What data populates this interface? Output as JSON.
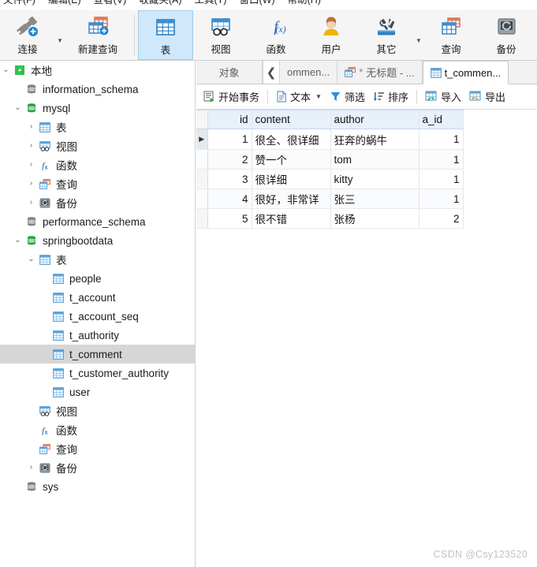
{
  "window": {
    "menu": [
      {
        "label": "文件(F)"
      },
      {
        "label": "编辑(E)"
      },
      {
        "label": "查看(V)"
      },
      {
        "label": "收藏夹(A)"
      },
      {
        "label": "工具(T)"
      },
      {
        "label": "窗口(W)"
      },
      {
        "label": "帮助(H)"
      }
    ]
  },
  "ribbon": {
    "buttons": [
      {
        "label": "连接",
        "icon": "connection-icon",
        "caret": true,
        "active": false
      },
      {
        "label": "新建查询",
        "icon": "new-query-icon",
        "caret": false,
        "active": false
      },
      {
        "label": "表",
        "icon": "table-icon",
        "caret": false,
        "active": true
      },
      {
        "label": "视图",
        "icon": "view-icon",
        "caret": false,
        "active": false
      },
      {
        "label": "函数",
        "icon": "function-icon",
        "caret": false,
        "active": false
      },
      {
        "label": "用户",
        "icon": "user-icon",
        "caret": false,
        "active": false
      },
      {
        "label": "其它",
        "icon": "other-tools-icon",
        "caret": true,
        "active": false
      },
      {
        "label": "查询",
        "icon": "query-icon",
        "caret": false,
        "active": false
      },
      {
        "label": "备份",
        "icon": "backup-icon",
        "caret": false,
        "active": false
      }
    ]
  },
  "tree": {
    "nodes": [
      {
        "label": "本地",
        "indent": 0,
        "twist": "down",
        "icon": "connection-green-icon",
        "selected": false
      },
      {
        "label": "information_schema",
        "indent": 1,
        "twist": "none",
        "icon": "database-gray-icon",
        "selected": false
      },
      {
        "label": "mysql",
        "indent": 1,
        "twist": "down",
        "icon": "database-green-icon",
        "selected": false
      },
      {
        "label": "表",
        "indent": 2,
        "twist": "right",
        "icon": "table-icon",
        "selected": false
      },
      {
        "label": "视图",
        "indent": 2,
        "twist": "right",
        "icon": "view-icon",
        "selected": false
      },
      {
        "label": "函数",
        "indent": 2,
        "twist": "right",
        "icon": "function-icon",
        "selected": false
      },
      {
        "label": "查询",
        "indent": 2,
        "twist": "right",
        "icon": "query-icon",
        "selected": false
      },
      {
        "label": "备份",
        "indent": 2,
        "twist": "right",
        "icon": "backup-icon",
        "selected": false
      },
      {
        "label": "performance_schema",
        "indent": 1,
        "twist": "none",
        "icon": "database-gray-icon",
        "selected": false
      },
      {
        "label": "springbootdata",
        "indent": 1,
        "twist": "down",
        "icon": "database-green-icon",
        "selected": false
      },
      {
        "label": "表",
        "indent": 2,
        "twist": "down",
        "icon": "table-icon",
        "selected": false
      },
      {
        "label": "people",
        "indent": 3,
        "twist": "none",
        "icon": "table-icon",
        "selected": false
      },
      {
        "label": "t_account",
        "indent": 3,
        "twist": "none",
        "icon": "table-icon",
        "selected": false
      },
      {
        "label": "t_account_seq",
        "indent": 3,
        "twist": "none",
        "icon": "table-icon",
        "selected": false
      },
      {
        "label": "t_authority",
        "indent": 3,
        "twist": "none",
        "icon": "table-icon",
        "selected": false
      },
      {
        "label": "t_comment",
        "indent": 3,
        "twist": "none",
        "icon": "table-icon",
        "selected": true
      },
      {
        "label": "t_customer_authority",
        "indent": 3,
        "twist": "none",
        "icon": "table-icon",
        "selected": false
      },
      {
        "label": "user",
        "indent": 3,
        "twist": "none",
        "icon": "table-icon",
        "selected": false
      },
      {
        "label": "视图",
        "indent": 2,
        "twist": "none",
        "icon": "view-icon",
        "selected": false
      },
      {
        "label": "函数",
        "indent": 2,
        "twist": "none",
        "icon": "function-icon",
        "selected": false
      },
      {
        "label": "查询",
        "indent": 2,
        "twist": "none",
        "icon": "query-icon",
        "selected": false
      },
      {
        "label": "备份",
        "indent": 2,
        "twist": "right",
        "icon": "backup-icon",
        "selected": false
      },
      {
        "label": "sys",
        "indent": 1,
        "twist": "none",
        "icon": "database-gray-icon",
        "selected": false
      }
    ]
  },
  "tabs": {
    "object_label": "对象",
    "scroll_left_glyph": "❮",
    "items": [
      {
        "label": "ommen...",
        "icon": "table-icon",
        "star": "",
        "active": false
      },
      {
        "label": "无标题 - ...",
        "icon": "query-icon",
        "star": "*",
        "active": false
      },
      {
        "label": "t_commen...",
        "icon": "table-icon",
        "star": "",
        "active": true
      }
    ]
  },
  "gridbar": {
    "buttons": [
      {
        "label": "开始事务",
        "icon": "transaction-icon",
        "caret": false
      },
      {
        "label": "文本",
        "icon": "text-icon",
        "caret": true
      },
      {
        "label": "筛选",
        "icon": "filter-icon",
        "caret": false
      },
      {
        "label": "排序",
        "icon": "sort-icon",
        "caret": false
      },
      {
        "label": "导入",
        "icon": "import-icon",
        "caret": false
      },
      {
        "label": "导出",
        "icon": "export-icon",
        "caret": false
      }
    ]
  },
  "grid": {
    "columns": [
      "id",
      "content",
      "author",
      "a_id"
    ],
    "rows": [
      {
        "id": "1",
        "content": "很全、很详细",
        "author": "狂奔的蜗牛",
        "a_id": "1",
        "current": true
      },
      {
        "id": "2",
        "content": "赞一个",
        "author": "tom",
        "a_id": "1",
        "current": false
      },
      {
        "id": "3",
        "content": "很详细",
        "author": "kitty",
        "a_id": "1",
        "current": false
      },
      {
        "id": "4",
        "content": "很好，非常详",
        "author": "张三",
        "a_id": "1",
        "current": false
      },
      {
        "id": "5",
        "content": "很不错",
        "author": "张杨",
        "a_id": "2",
        "current": false
      }
    ]
  },
  "watermark": {
    "text": "CSDN @Csy123520"
  },
  "colors": {
    "ribbon_bg": "#f5f5f5",
    "ribbon_active": "#cfe8fb",
    "tree_selected": "#d6d6d6",
    "grid_header": "#e8f0fa",
    "accent_blue": "#1e7ac4",
    "db_green": "#23a13f",
    "watermark": "#c3c3c3"
  }
}
